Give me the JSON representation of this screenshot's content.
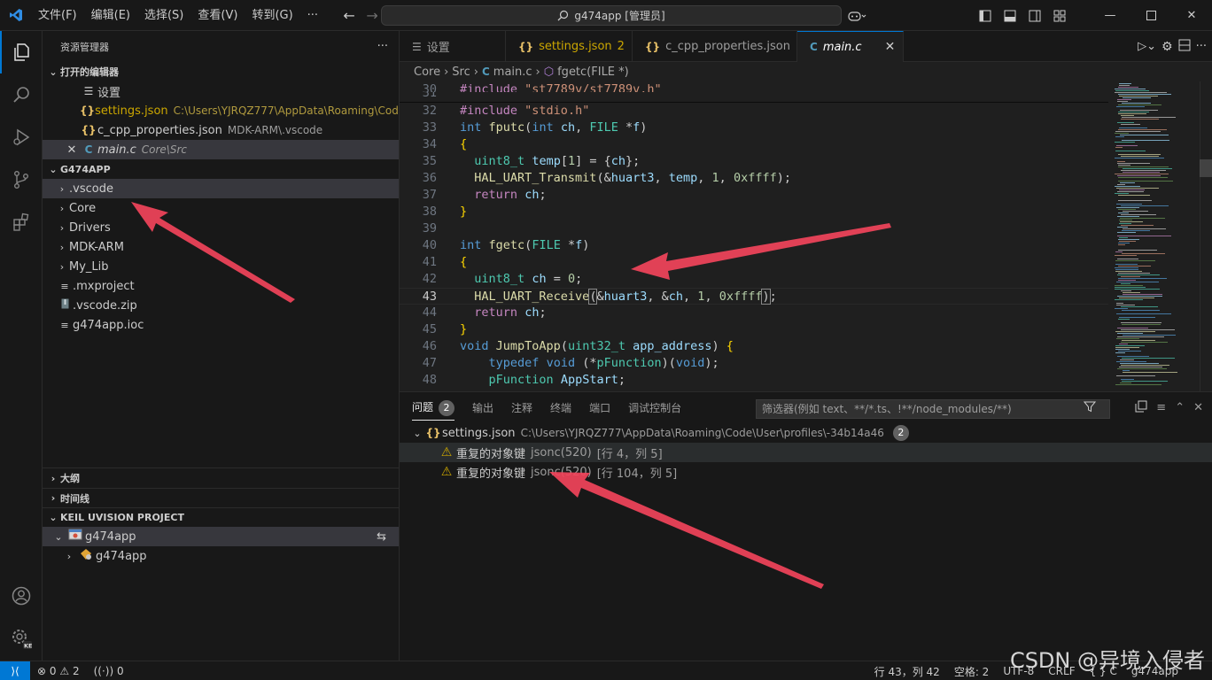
{
  "window": {
    "title": "g474app [管理员]"
  },
  "menu": [
    "文件(F)",
    "编辑(E)",
    "选择(S)",
    "查看(V)",
    "转到(G)",
    "···"
  ],
  "sidebar": {
    "title": "资源管理器",
    "open_editors_label": "打开的编辑器",
    "open_editors": [
      {
        "icon": "settings-lines-icon",
        "name": "设置",
        "path": ""
      },
      {
        "icon": "json-icon",
        "name": "settings.json",
        "path": "C:\\Users\\YJRQZ777\\AppData\\Roaming\\Cod...",
        "count": "2"
      },
      {
        "icon": "json-icon",
        "name": "c_cpp_properties.json",
        "path": "MDK-ARM\\.vscode"
      },
      {
        "icon": "c-icon",
        "name": "main.c",
        "path": "Core\\Src"
      }
    ],
    "workspace_label": "G474APP",
    "tree": [
      {
        "name": ".vscode",
        "type": "folder"
      },
      {
        "name": "Core",
        "type": "folder"
      },
      {
        "name": "Drivers",
        "type": "folder"
      },
      {
        "name": "MDK-ARM",
        "type": "folder"
      },
      {
        "name": "My_Lib",
        "type": "folder"
      },
      {
        "name": ".mxproject",
        "type": "file"
      },
      {
        "name": ".vscode.zip",
        "type": "zip"
      },
      {
        "name": "g474app.ioc",
        "type": "file"
      }
    ],
    "outline_label": "大纲",
    "timeline_label": "时间线",
    "keil_label": "KEIL UVISION PROJECT",
    "keil_items": [
      "g474app",
      "g474app"
    ]
  },
  "tabs": [
    {
      "name": "设置",
      "icon": "settings-lines-icon",
      "badge": ""
    },
    {
      "name": "settings.json",
      "icon": "json-icon",
      "badge": "2"
    },
    {
      "name": "c_cpp_properties.json",
      "icon": "json-icon",
      "badge": ""
    },
    {
      "name": "main.c",
      "icon": "c-icon",
      "badge": ""
    }
  ],
  "breadcrumb": [
    "Core",
    "Src",
    "main.c",
    "fgetc(FILE *)"
  ],
  "code": {
    "line_numbers": [
      "30",
      "31",
      "32",
      "33",
      "34",
      "35",
      "36",
      "37",
      "38",
      "39",
      "40",
      "41",
      "42",
      "43",
      "44",
      "45",
      "46",
      "47",
      "48"
    ],
    "current_line": "43"
  },
  "panel": {
    "tabs": [
      "问题",
      "输出",
      "注释",
      "终端",
      "端口",
      "调试控制台"
    ],
    "problems_count": "2",
    "filter_placeholder": "筛选器(例如 text、**/*.ts、!**/node_modules/**)",
    "group": {
      "file": "settings.json",
      "path": "C:\\Users\\YJRQZ777\\AppData\\Roaming\\Code\\User\\profiles\\-34b14a46",
      "count": "2"
    },
    "problems": [
      {
        "message": "重复的对象键",
        "source": "jsonc(520)",
        "location": "[行 4，列 5]"
      },
      {
        "message": "重复的对象键",
        "source": "jsonc(520)",
        "location": "[行 104，列 5]"
      }
    ]
  },
  "status": {
    "errors": "0",
    "warnings": "2",
    "ports": "0",
    "cursor": "行 43，列 42",
    "spaces": "空格: 2",
    "encoding": "UTF-8",
    "eol": "CRLF",
    "language": "{ } C",
    "project": "g474app"
  },
  "watermark": "CSDN @异境入侵者",
  "colors": {
    "accent": "#0078d4",
    "warning": "#cca700",
    "arrow": "#f2445b"
  }
}
